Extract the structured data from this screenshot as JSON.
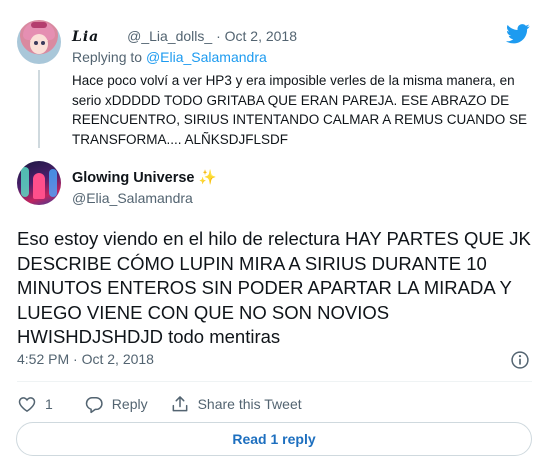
{
  "parent_tweet": {
    "display_name": "Lia",
    "handle": "@_Lia_dolls_",
    "separator": "·",
    "date": "Oct 2, 2018",
    "replying_prefix": "Replying to",
    "replying_to": "@Elia_Salamandra",
    "text": "Hace poco volví a ver HP3 y era imposible verles de la misma manera, en serio xDDDDD TODO GRITABA QUE ERAN PAREJA. ESE ABRAZO DE REENCUENTRO, SIRIUS INTENTANDO CALMAR A REMUS CUANDO SE TRANSFORMA.... ALÑKSDJFLSDF"
  },
  "main_tweet": {
    "display_name": "Glowing Universe",
    "name_emoji": "✨",
    "handle": "@Elia_Salamandra",
    "text": "Eso estoy viendo en el hilo de relectura HAY PARTES QUE JK DESCRIBE CÓMO LUPIN MIRA A SIRIUS DURANTE 10 MINUTOS ENTEROS SIN PODER APARTAR LA MIRADA Y LUEGO VIENE CON QUE NO SON NOVIOS HWISHDJSHDJD todo mentiras",
    "time": "4:52 PM",
    "separator": "·",
    "date": "Oct 2, 2018"
  },
  "actions": {
    "like_count": "1",
    "reply_label": "Reply",
    "share_label": "Share this Tweet"
  },
  "read_replies_label": "Read 1 reply",
  "colors": {
    "accent": "#1d9bf0",
    "text_secondary": "#536471",
    "border": "#cfd9de",
    "read_button_text": "#1d6fbf"
  },
  "icons": [
    "twitter-bird-icon",
    "info-icon",
    "heart-icon",
    "reply-bubble-icon",
    "share-icon",
    "sparkles-icon"
  ]
}
